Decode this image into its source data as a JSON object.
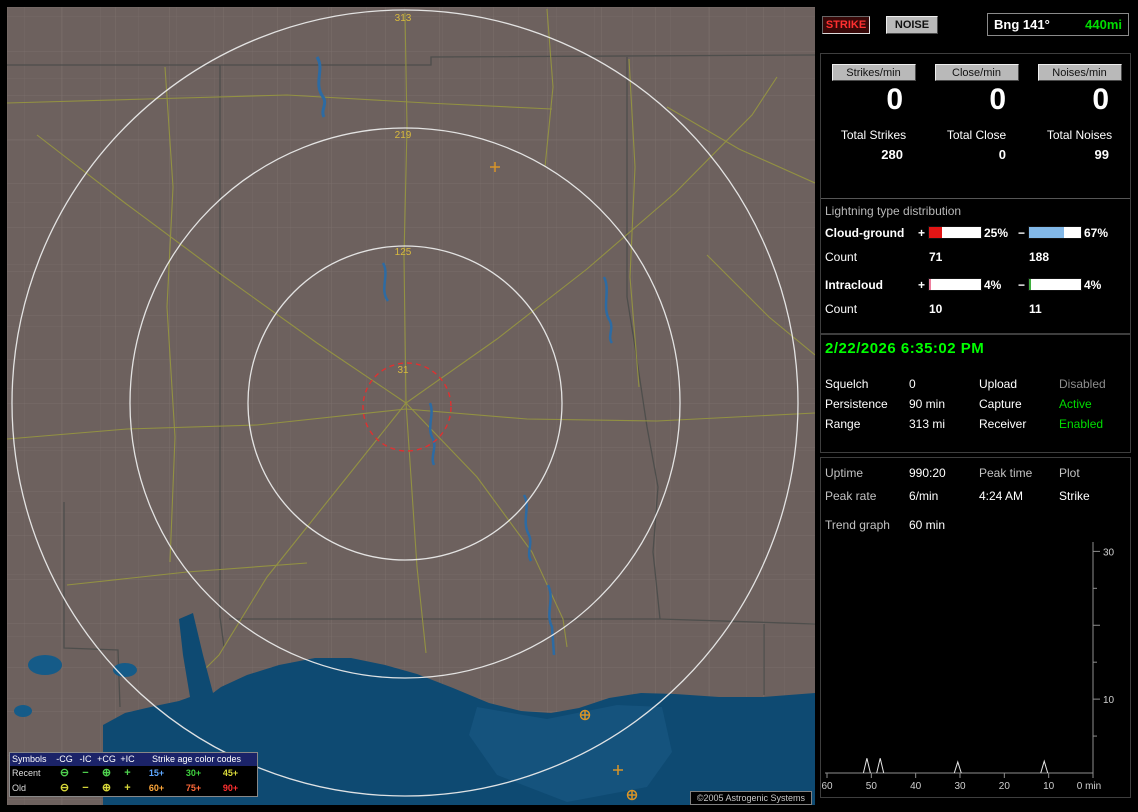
{
  "toolbar": {
    "strike": "STRIKE",
    "noise": "NOISE",
    "bearing": "Bng 141°",
    "distance": "440mi"
  },
  "stats": {
    "columns": [
      {
        "button": "Strikes/min",
        "rate": "0",
        "total_label": "Total Strikes",
        "total_value": "280"
      },
      {
        "button": "Close/min",
        "rate": "0",
        "total_label": "Total Close",
        "total_value": "0"
      },
      {
        "button": "Noises/min",
        "rate": "0",
        "total_label": "Total Noises",
        "total_value": "99"
      }
    ]
  },
  "distribution": {
    "title": "Lightning type distribution",
    "cloud_ground": {
      "label": "Cloud-ground",
      "plus_sign": "+",
      "minus_sign": "−",
      "plus_pct": "25%",
      "minus_pct": "67%",
      "plus_fill_pct": 25,
      "minus_fill_pct": 67,
      "plus_color": "#e31515",
      "minus_color": "#82b8e8",
      "count_label": "Count",
      "plus_count": "71",
      "minus_count": "188"
    },
    "intracloud": {
      "label": "Intracloud",
      "plus_sign": "+",
      "minus_sign": "−",
      "plus_pct": "4%",
      "minus_pct": "4%",
      "plus_fill_pct": 4,
      "minus_fill_pct": 4,
      "plus_color": "#ee7f9e",
      "minus_color": "#3fae3f",
      "count_label": "Count",
      "plus_count": "10",
      "minus_count": "11"
    }
  },
  "status": {
    "datetime": "2/22/2026 6:35:02 PM",
    "rows": [
      {
        "l1": "Squelch",
        "v1": "0",
        "l2": "Upload",
        "v2": "Disabled"
      },
      {
        "l1": "Persistence",
        "v1": "90 min",
        "l2": "Capture",
        "v2": "Active"
      },
      {
        "l1": "Range",
        "v1": "313 mi",
        "l2": "Receiver",
        "v2": "Enabled"
      }
    ]
  },
  "session": {
    "uptime_label": "Uptime",
    "uptime_value": "990:20",
    "peak_time_label": "Peak time",
    "peak_time_value": "4:24 AM",
    "plot_label": "Plot",
    "plot_value": "Strike",
    "peak_rate_label": "Peak rate",
    "peak_rate_value": "6/min",
    "trend_label": "Trend graph",
    "trend_value": "60 min"
  },
  "colors": {
    "green": "#00dd00",
    "bright_green": "#00ff00",
    "disabled_gray": "#8e8e8e",
    "strike_red": "#ff3030"
  },
  "map": {
    "range_labels": [
      "313",
      "219",
      "125",
      "31"
    ],
    "legend": {
      "header_symbols": "Symbols",
      "header_cols": [
        "-CG",
        "-IC",
        "+CG",
        "+IC"
      ],
      "header_age": "Strike age color codes",
      "rows": [
        {
          "label": "Recent",
          "symbol_color": "#4fd24f",
          "symbols": [
            "⊖",
            "−",
            "⊕",
            "+"
          ],
          "age_codes": [
            {
              "text": "15+",
              "color": "#5fa8ff"
            },
            {
              "text": "30+",
              "color": "#3fd23f"
            },
            {
              "text": "45+",
              "color": "#d8d83a"
            }
          ]
        },
        {
          "label": "Old",
          "symbol_color": "#d8d83a",
          "symbols": [
            "⊖",
            "−",
            "⊕",
            "+"
          ],
          "age_codes": [
            {
              "text": "60+",
              "color": "#ffa83a"
            },
            {
              "text": "75+",
              "color": "#ff6a3a"
            },
            {
              "text": "90+",
              "color": "#ff3030"
            }
          ]
        }
      ]
    },
    "copyright": "©2005 Astrogenic Systems"
  },
  "chart_data": {
    "type": "area",
    "x_range_minutes": [
      60,
      0
    ],
    "x_ticks": [
      "60",
      "50",
      "40",
      "30",
      "20",
      "10"
    ],
    "x_end_label": "0 min",
    "y_max": 31,
    "y_ticks_labeled": [
      30,
      10
    ],
    "spikes": [
      {
        "minutes_ago": 51,
        "peak": 2
      },
      {
        "minutes_ago": 48,
        "peak": 2
      },
      {
        "minutes_ago": 30.5,
        "peak": 1.5
      },
      {
        "minutes_ago": 11,
        "peak": 1.6
      }
    ]
  }
}
